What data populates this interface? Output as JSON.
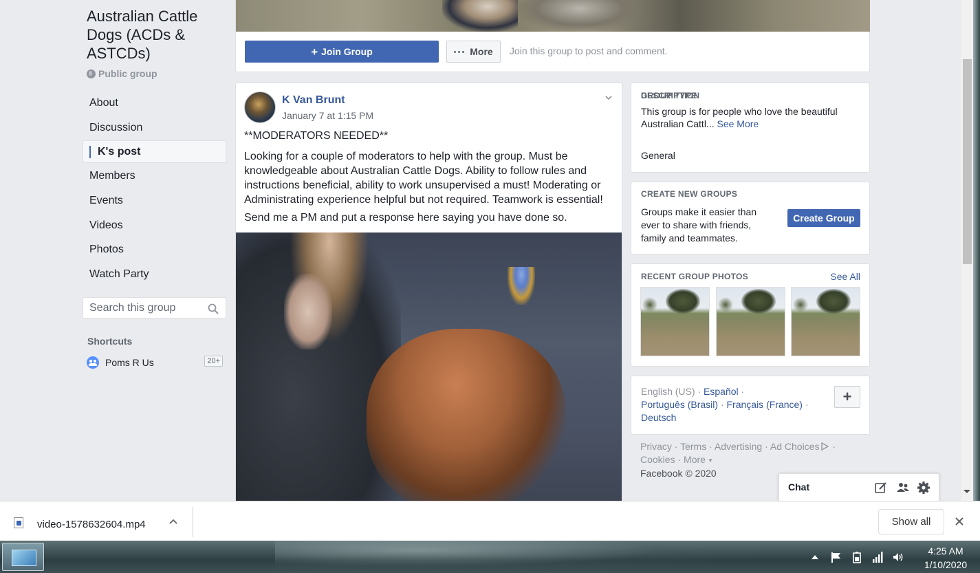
{
  "group": {
    "title": "Australian Cattle Dogs (ACDs & ASTCDs)",
    "privacy": "Public group"
  },
  "nav": {
    "items": [
      {
        "label": "About"
      },
      {
        "label": "Discussion"
      },
      {
        "label": "K's post",
        "active": true
      },
      {
        "label": "Members"
      },
      {
        "label": "Events"
      },
      {
        "label": "Videos"
      },
      {
        "label": "Photos"
      },
      {
        "label": "Watch Party"
      }
    ]
  },
  "search": {
    "placeholder": "Search this group"
  },
  "shortcuts": {
    "title": "Shortcuts",
    "items": [
      {
        "label": "Poms R Us",
        "badge": "20+"
      }
    ]
  },
  "header_actions": {
    "join_label": "Join Group",
    "more_label": "More",
    "hint": "Join this group to post and comment."
  },
  "post": {
    "author": "K Van Brunt",
    "time": "January 7 at 1:15 PM",
    "heading": "**MODERATORS NEEDED**",
    "body": "Looking for a couple of moderators to help with the group. Must be knowledgeable about Australian Cattle Dogs. Ability to follow rules and instructions beneficial, ability to work unsupervised a must! Moderating or Administrating experience helpful but not required. Teamwork is essential!",
    "cta": "Send me a PM and put a response here saying you have done so."
  },
  "description": {
    "header": "DESCRIPTION",
    "text": "This group is for people who love the beautiful Australian Cattl...",
    "see_more": "See More",
    "type_header": "GROUP TYPE",
    "type_value": "General"
  },
  "create_groups": {
    "header": "CREATE NEW GROUPS",
    "text": "Groups make it easier than ever to share with friends, family and teammates.",
    "button": "Create Group"
  },
  "recent_photos": {
    "header": "RECENT GROUP PHOTOS",
    "see_all": "See All",
    "count": 3
  },
  "languages": {
    "current": "English (US)",
    "others": [
      "Español",
      "Português (Brasil)",
      "Français (France)",
      "Deutsch"
    ],
    "sep": "·",
    "add_label": "+"
  },
  "footer": {
    "links": [
      "Privacy",
      "Terms",
      "Advertising",
      "Ad Choices",
      "Cookies",
      "More"
    ],
    "sep": "·",
    "copyright": "Facebook © 2020"
  },
  "chat": {
    "label": "Chat",
    "icons": [
      "compose-icon",
      "people-icon",
      "gear-icon"
    ]
  },
  "download_bar": {
    "filename": "video-1578632604.mp4",
    "show_all": "Show all"
  },
  "taskbar": {
    "time": "4:25 AM",
    "date": "1/10/2020"
  },
  "colors": {
    "brand_blue": "#4267b2",
    "link_blue": "#365899",
    "page_bg": "#e9ebee"
  }
}
